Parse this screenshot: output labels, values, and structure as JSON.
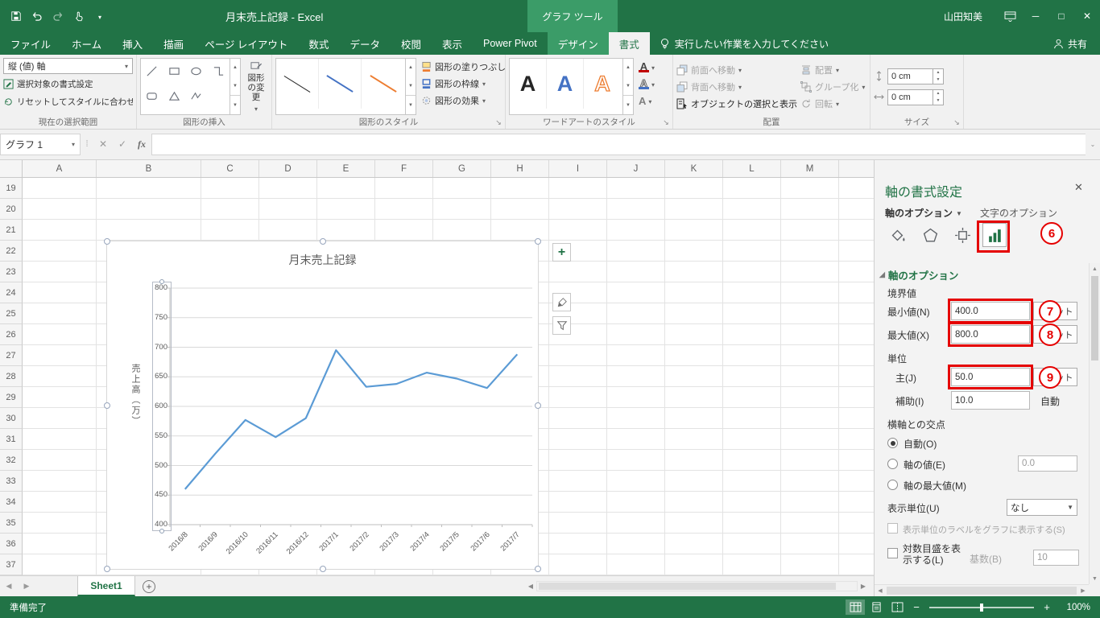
{
  "title_bar": {
    "document_title": "月末売上記録  -  Excel",
    "contextual_group_label": "グラフ ツール",
    "user_name": "山田知美",
    "quick_access_icons": [
      "save-icon",
      "undo-icon",
      "redo-icon",
      "touch-mode-icon",
      "customize-qat-icon"
    ],
    "window_controls": {
      "minimize": "─",
      "maximize": "□",
      "close": "✕"
    }
  },
  "ribbon": {
    "tabs": [
      "ファイル",
      "ホーム",
      "挿入",
      "描画",
      "ページ レイアウト",
      "数式",
      "データ",
      "校閲",
      "表示",
      "Power Pivot",
      "デザイン",
      "書式"
    ],
    "active_tab": "書式",
    "contextual_tabs": [
      "デザイン",
      "書式"
    ],
    "tell_me_label": "実行したい作業を入力してください",
    "share_label": "共有",
    "current_selection": {
      "group_label": "現在の選択範囲",
      "selector_value": "縦 (値) 軸",
      "format_selection_label": "選択対象の書式設定",
      "reset_label": "リセットしてスタイルに合わせる"
    },
    "insert_shapes": {
      "group_label": "図形の挿入",
      "edit_shape_label": "図形の変更",
      "shape_icons": [
        "line-icon",
        "rectangle-icon",
        "ellipse-icon",
        "elbow-connector-icon",
        "rounded-rectangle-icon",
        "triangle-icon",
        "freeform-icon"
      ]
    },
    "shape_styles": {
      "group_label": "図形のスタイル",
      "fill_label": "図形の塗りつぶし",
      "outline_label": "図形の枠線",
      "effects_label": "図形の効果",
      "preset_colors": [
        "#2b2b2b",
        "#4472c4",
        "#ed7d31"
      ]
    },
    "wordart_styles": {
      "group_label": "ワードアートのスタイル",
      "sample_letter": "A",
      "sample_colors": [
        "#262626",
        "#4472c4",
        "#ed7d31"
      ]
    },
    "arrange": {
      "group_label": "配置",
      "items": [
        "前面へ移動",
        "背面へ移動",
        "オブジェクトの選択と表示",
        "配置",
        "グループ化",
        "回転"
      ]
    },
    "size": {
      "group_label": "サイズ",
      "height_value": "0 cm",
      "width_value": "0 cm"
    }
  },
  "formula_bar": {
    "name_box_value": "グラフ 1",
    "fx_label": "fx",
    "formula_value": ""
  },
  "grid": {
    "column_headers": [
      "A",
      "B",
      "C",
      "D",
      "E",
      "F",
      "G",
      "H",
      "I",
      "J",
      "K",
      "L",
      "M"
    ],
    "row_headers": [
      "19",
      "20",
      "21",
      "22",
      "23",
      "24",
      "25",
      "26",
      "27",
      "28",
      "29",
      "30",
      "31",
      "32",
      "33",
      "34",
      "35",
      "36",
      "37"
    ]
  },
  "chart_data": {
    "type": "line",
    "title": "月末売上記録",
    "categories": [
      "2016/8",
      "2016/9",
      "2016/10",
      "2016/11",
      "2016/12",
      "2017/1",
      "2017/2",
      "2017/3",
      "2017/4",
      "2017/5",
      "2017/6",
      "2017/7"
    ],
    "values": [
      460,
      520,
      577,
      548,
      580,
      695,
      633,
      638,
      657,
      647,
      631,
      688
    ],
    "ylabel": "売上高（万）",
    "ylim": [
      400,
      800
    ],
    "ytick_step": 50,
    "line_color": "#5b9bd5",
    "grid": true,
    "legend": "none"
  },
  "chart_buttons": [
    "chart-elements-plus-icon",
    "chart-styles-brush-icon",
    "chart-filters-funnel-icon"
  ],
  "task_pane": {
    "title": "軸の書式設定",
    "close_glyph": "✕",
    "tabs": {
      "axis_options": "軸のオプション",
      "text_options": "文字のオプション"
    },
    "icon_names": [
      "fill-line-icon",
      "effects-icon",
      "size-properties-icon",
      "axis-options-chart-icon"
    ],
    "section_header": "軸のオプション",
    "bounds": {
      "label": "境界値",
      "min_label": "最小値(N)",
      "min_value": "400.0",
      "max_label": "最大値(X)",
      "max_value": "800.0",
      "reset_label": "リセット"
    },
    "units": {
      "label": "単位",
      "major_label": "主(J)",
      "major_value": "50.0",
      "minor_label": "補助(I)",
      "minor_value": "10.0",
      "auto_label": "自動"
    },
    "crosses": {
      "label": "横軸との交点",
      "auto_label": "自動(O)",
      "value_label": "軸の値(E)",
      "value": "0.0",
      "max_label": "軸の最大値(M)"
    },
    "display_units": {
      "label": "表示単位(U)",
      "value": "なし"
    },
    "show_units_label": "表示単位のラベルをグラフに表示する(S)",
    "log_scale_label": "対数目盛を表示する(L)",
    "base_label": "基数(B)",
    "base_value": "10"
  },
  "annotations": {
    "icon_badge": "6",
    "min_badge": "7",
    "max_badge": "8",
    "major_badge": "9"
  },
  "sheet_bar": {
    "active_tab": "Sheet1"
  },
  "status_bar": {
    "mode_label": "準備完了",
    "zoom_label": "100%",
    "view_icons": [
      "normal-view-icon",
      "page-layout-view-icon",
      "page-break-preview-icon"
    ]
  }
}
